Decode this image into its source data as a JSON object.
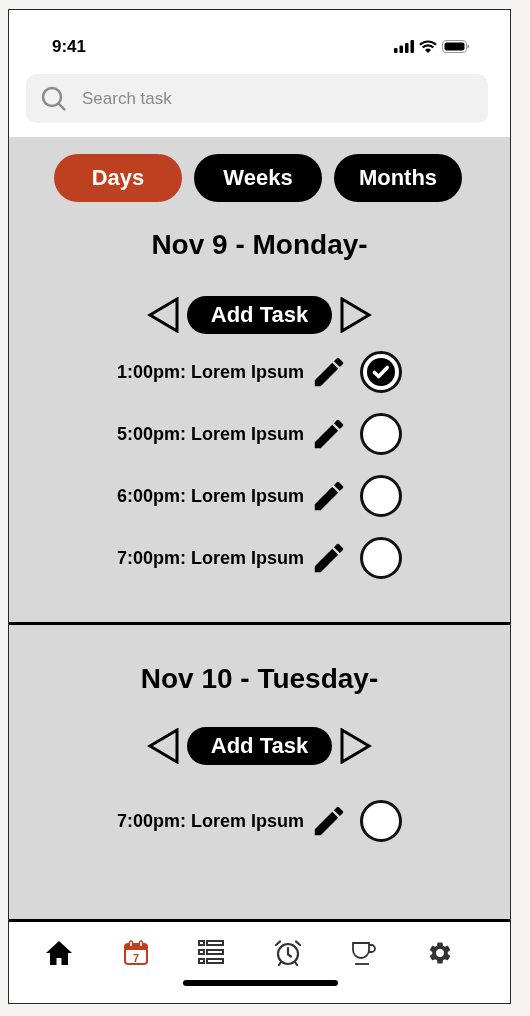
{
  "status_bar": {
    "time": "9:41"
  },
  "search": {
    "placeholder": "Search task"
  },
  "view_tabs": [
    {
      "label": "Days",
      "selected": true
    },
    {
      "label": "Weeks",
      "selected": false
    },
    {
      "label": "Months",
      "selected": false
    }
  ],
  "days": [
    {
      "title": "Nov 9 - Monday-",
      "add_button": "Add Task",
      "tasks": [
        {
          "text": "1:00pm: Lorem Ipsum",
          "done": true
        },
        {
          "text": "5:00pm: Lorem Ipsum",
          "done": false
        },
        {
          "text": "6:00pm: Lorem Ipsum",
          "done": false
        },
        {
          "text": "7:00pm: Lorem Ipsum",
          "done": false
        }
      ]
    },
    {
      "title": "Nov 10 - Tuesday-",
      "add_button": "Add Task",
      "tasks": [
        {
          "text": "7:00pm: Lorem Ipsum",
          "done": false
        }
      ]
    }
  ],
  "bottom_nav": [
    {
      "selected": false
    },
    {
      "label": "7",
      "selected": true
    },
    {
      "selected": false
    },
    {
      "selected": false
    },
    {
      "selected": false
    },
    {
      "selected": false
    }
  ]
}
